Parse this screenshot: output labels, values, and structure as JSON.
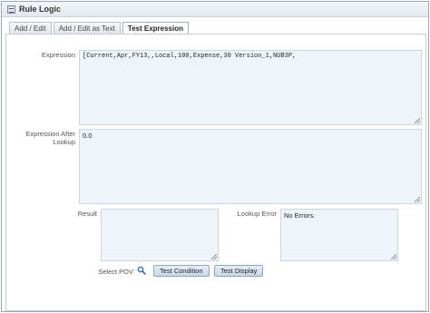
{
  "window": {
    "title": "Rule Logic"
  },
  "tabs": [
    {
      "label": "Add / Edit"
    },
    {
      "label": "Add / Edit as Text"
    },
    {
      "label": "Test Expression"
    }
  ],
  "fields": {
    "expression_label": "Expression",
    "expression_value": "[Current,Apr,FY13,,Local,100,Expense,30 Version_1,NUB3P,",
    "expression_after_lookup_label": "Expression After Lookup",
    "expression_after_lookup_value": "0.0",
    "result_label": "Result",
    "result_value": "",
    "lookup_error_label": "Lookup Error",
    "lookup_error_value": "No Errors."
  },
  "actions": {
    "select_pov_label": "Select POV",
    "test_condition_label": "Test Condition",
    "test_display_label": "Test Display"
  },
  "icons": {
    "title": "rule-logic-icon",
    "pov": "search-icon"
  }
}
